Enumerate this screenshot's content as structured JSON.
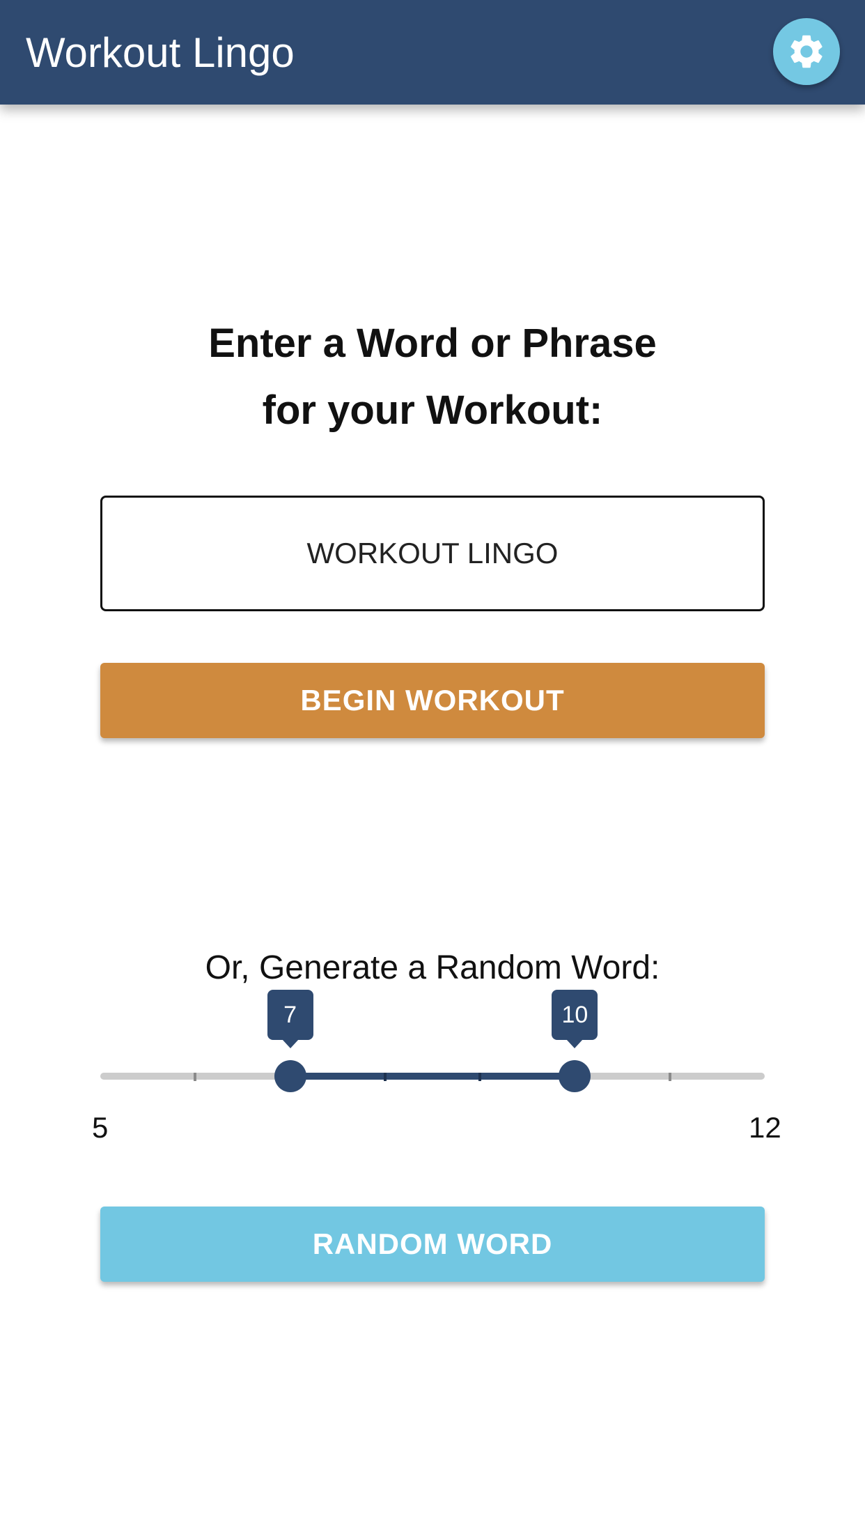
{
  "app_bar": {
    "title": "Workout Lingo",
    "settings_icon": "gear-icon",
    "color": "#2f4a70",
    "settings_color": "#74c8e3"
  },
  "main": {
    "heading_line1": "Enter a Word or Phrase",
    "heading_line2": "for your Workout:",
    "word_input": {
      "value": "WORKOUT LINGO",
      "placeholder": ""
    },
    "begin_button": {
      "label": "BEGIN WORKOUT",
      "color": "#cf8a3e"
    }
  },
  "random": {
    "label": "Or, Generate a Random Word:",
    "slider": {
      "min": 5,
      "max": 12,
      "low": 7,
      "high": 10,
      "min_label": "5",
      "max_label": "12",
      "low_label": "7",
      "high_label": "10"
    },
    "random_button": {
      "label": "RANDOM WORD",
      "color": "#72c7e2"
    }
  }
}
